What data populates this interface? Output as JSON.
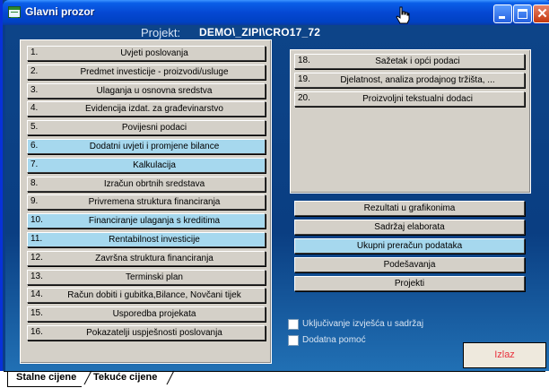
{
  "window": {
    "title": "Glavni prozor"
  },
  "header": {
    "project_label": "Projekt:",
    "project_value": "DEMO\\_ZIPI\\CRO17_72"
  },
  "left_items": [
    {
      "num": "1.",
      "label": "Uvjeti poslovanja",
      "highlight": false
    },
    {
      "num": "2.",
      "label": "Predmet investicije - proizvodi/usluge",
      "highlight": false
    },
    {
      "num": "3.",
      "label": "Ulaganja u osnovna sredstva",
      "highlight": false
    },
    {
      "num": "4.",
      "label": "Evidencija izdat. za građevinarstvo",
      "highlight": false
    },
    {
      "num": "5.",
      "label": "Povijesni podaci",
      "highlight": false
    },
    {
      "num": "6.",
      "label": "Dodatni uvjeti i promjene bilance",
      "highlight": true
    },
    {
      "num": "7.",
      "label": "Kalkulacija",
      "highlight": true
    },
    {
      "num": "8.",
      "label": "Izračun obrtnih sredstava",
      "highlight": false
    },
    {
      "num": "9.",
      "label": "Privremena struktura financiranja",
      "highlight": false
    },
    {
      "num": "10.",
      "label": "Financiranje ulaganja s kreditima",
      "highlight": true
    },
    {
      "num": "11.",
      "label": "Rentabilnost investicije",
      "highlight": true
    },
    {
      "num": "12.",
      "label": "Završna struktura financiranja",
      "highlight": false
    },
    {
      "num": "13.",
      "label": "Terminski plan",
      "highlight": false
    },
    {
      "num": "14.",
      "label": "Račun dobiti i gubitka,Bilance, Novčani tijek",
      "highlight": false
    },
    {
      "num": "15.",
      "label": "Usporedba projekata",
      "highlight": false
    },
    {
      "num": "16.",
      "label": "Pokazatelji uspješnosti poslovanja",
      "highlight": false
    }
  ],
  "right_items": [
    {
      "num": "18.",
      "label": "Sažetak i opći podaci"
    },
    {
      "num": "19.",
      "label": "Djelatnost,  analiza prodajnog tržišta, ..."
    },
    {
      "num": "20.",
      "label": "Proizvoljni tekstualni dodaci"
    }
  ],
  "actions": [
    {
      "label": "Rezultati u grafikonima",
      "highlight": false
    },
    {
      "label": "Sadržaj elaborata",
      "highlight": false
    },
    {
      "label": "Ukupni preračun podataka",
      "highlight": true
    },
    {
      "label": "Podešavanja",
      "highlight": false
    },
    {
      "label": "Projekti",
      "highlight": false
    }
  ],
  "options": {
    "include_reports": "Uključivanje izvješća u sadržaj",
    "extra_help": "Dodatna pomoć"
  },
  "exit_label": "Izlaz",
  "tabs": {
    "stalne": "Stalne cijene",
    "tekuce": "Tekuće cijene"
  },
  "colors": {
    "highlight": "#a6d8ee",
    "button": "#d4d0c8",
    "exit_text": "#e8303c"
  }
}
